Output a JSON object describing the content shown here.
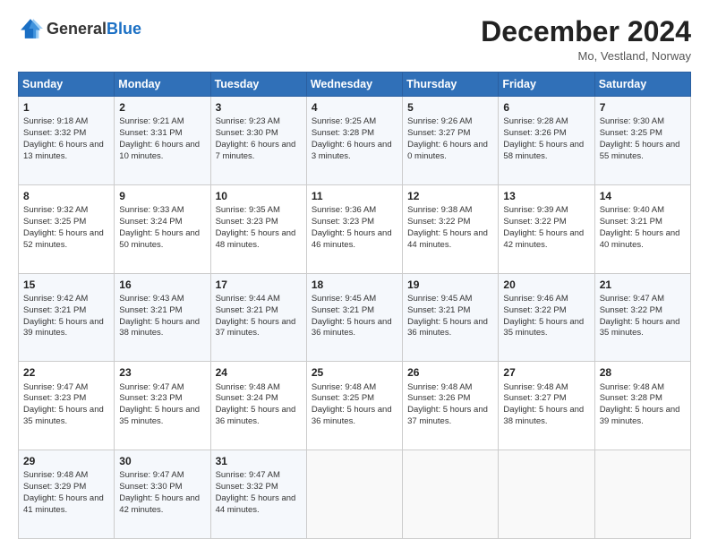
{
  "header": {
    "logo_general": "General",
    "logo_blue": "Blue",
    "month_year": "December 2024",
    "location": "Mo, Vestland, Norway"
  },
  "days_of_week": [
    "Sunday",
    "Monday",
    "Tuesday",
    "Wednesday",
    "Thursday",
    "Friday",
    "Saturday"
  ],
  "weeks": [
    [
      {
        "day": "1",
        "sunrise": "9:18 AM",
        "sunset": "3:32 PM",
        "daylight": "6 hours and 13 minutes."
      },
      {
        "day": "2",
        "sunrise": "9:21 AM",
        "sunset": "3:31 PM",
        "daylight": "6 hours and 10 minutes."
      },
      {
        "day": "3",
        "sunrise": "9:23 AM",
        "sunset": "3:30 PM",
        "daylight": "6 hours and 7 minutes."
      },
      {
        "day": "4",
        "sunrise": "9:25 AM",
        "sunset": "3:28 PM",
        "daylight": "6 hours and 3 minutes."
      },
      {
        "day": "5",
        "sunrise": "9:26 AM",
        "sunset": "3:27 PM",
        "daylight": "6 hours and 0 minutes."
      },
      {
        "day": "6",
        "sunrise": "9:28 AM",
        "sunset": "3:26 PM",
        "daylight": "5 hours and 58 minutes."
      },
      {
        "day": "7",
        "sunrise": "9:30 AM",
        "sunset": "3:25 PM",
        "daylight": "5 hours and 55 minutes."
      }
    ],
    [
      {
        "day": "8",
        "sunrise": "9:32 AM",
        "sunset": "3:25 PM",
        "daylight": "5 hours and 52 minutes."
      },
      {
        "day": "9",
        "sunrise": "9:33 AM",
        "sunset": "3:24 PM",
        "daylight": "5 hours and 50 minutes."
      },
      {
        "day": "10",
        "sunrise": "9:35 AM",
        "sunset": "3:23 PM",
        "daylight": "5 hours and 48 minutes."
      },
      {
        "day": "11",
        "sunrise": "9:36 AM",
        "sunset": "3:23 PM",
        "daylight": "5 hours and 46 minutes."
      },
      {
        "day": "12",
        "sunrise": "9:38 AM",
        "sunset": "3:22 PM",
        "daylight": "5 hours and 44 minutes."
      },
      {
        "day": "13",
        "sunrise": "9:39 AM",
        "sunset": "3:22 PM",
        "daylight": "5 hours and 42 minutes."
      },
      {
        "day": "14",
        "sunrise": "9:40 AM",
        "sunset": "3:21 PM",
        "daylight": "5 hours and 40 minutes."
      }
    ],
    [
      {
        "day": "15",
        "sunrise": "9:42 AM",
        "sunset": "3:21 PM",
        "daylight": "5 hours and 39 minutes."
      },
      {
        "day": "16",
        "sunrise": "9:43 AM",
        "sunset": "3:21 PM",
        "daylight": "5 hours and 38 minutes."
      },
      {
        "day": "17",
        "sunrise": "9:44 AM",
        "sunset": "3:21 PM",
        "daylight": "5 hours and 37 minutes."
      },
      {
        "day": "18",
        "sunrise": "9:45 AM",
        "sunset": "3:21 PM",
        "daylight": "5 hours and 36 minutes."
      },
      {
        "day": "19",
        "sunrise": "9:45 AM",
        "sunset": "3:21 PM",
        "daylight": "5 hours and 36 minutes."
      },
      {
        "day": "20",
        "sunrise": "9:46 AM",
        "sunset": "3:22 PM",
        "daylight": "5 hours and 35 minutes."
      },
      {
        "day": "21",
        "sunrise": "9:47 AM",
        "sunset": "3:22 PM",
        "daylight": "5 hours and 35 minutes."
      }
    ],
    [
      {
        "day": "22",
        "sunrise": "9:47 AM",
        "sunset": "3:23 PM",
        "daylight": "5 hours and 35 minutes."
      },
      {
        "day": "23",
        "sunrise": "9:47 AM",
        "sunset": "3:23 PM",
        "daylight": "5 hours and 35 minutes."
      },
      {
        "day": "24",
        "sunrise": "9:48 AM",
        "sunset": "3:24 PM",
        "daylight": "5 hours and 36 minutes."
      },
      {
        "day": "25",
        "sunrise": "9:48 AM",
        "sunset": "3:25 PM",
        "daylight": "5 hours and 36 minutes."
      },
      {
        "day": "26",
        "sunrise": "9:48 AM",
        "sunset": "3:26 PM",
        "daylight": "5 hours and 37 minutes."
      },
      {
        "day": "27",
        "sunrise": "9:48 AM",
        "sunset": "3:27 PM",
        "daylight": "5 hours and 38 minutes."
      },
      {
        "day": "28",
        "sunrise": "9:48 AM",
        "sunset": "3:28 PM",
        "daylight": "5 hours and 39 minutes."
      }
    ],
    [
      {
        "day": "29",
        "sunrise": "9:48 AM",
        "sunset": "3:29 PM",
        "daylight": "5 hours and 41 minutes."
      },
      {
        "day": "30",
        "sunrise": "9:47 AM",
        "sunset": "3:30 PM",
        "daylight": "5 hours and 42 minutes."
      },
      {
        "day": "31",
        "sunrise": "9:47 AM",
        "sunset": "3:32 PM",
        "daylight": "5 hours and 44 minutes."
      },
      null,
      null,
      null,
      null
    ]
  ]
}
